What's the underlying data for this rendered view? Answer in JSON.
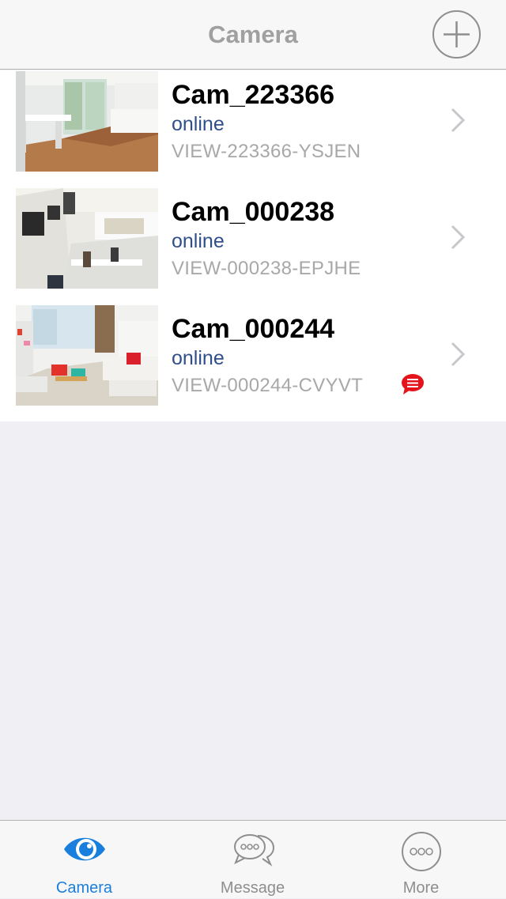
{
  "nav": {
    "title": "Camera"
  },
  "cameras": [
    {
      "name": "Cam_223366",
      "status": "online",
      "id": "VIEW-223366-YSJEN",
      "has_message": false
    },
    {
      "name": "Cam_000238",
      "status": "online",
      "id": "VIEW-000238-EPJHE",
      "has_message": false
    },
    {
      "name": "Cam_000244",
      "status": "online",
      "id": "VIEW-000244-CVYVT",
      "has_message": true
    }
  ],
  "tabs": [
    {
      "label": "Camera",
      "icon": "eye-icon",
      "active": true
    },
    {
      "label": "Message",
      "icon": "chat-bubbles-icon",
      "active": false
    },
    {
      "label": "More",
      "icon": "more-dots-icon",
      "active": false
    }
  ],
  "colors": {
    "accent": "#1a7fdc",
    "status": "#2f4f8a",
    "badge": "#e5141b"
  }
}
